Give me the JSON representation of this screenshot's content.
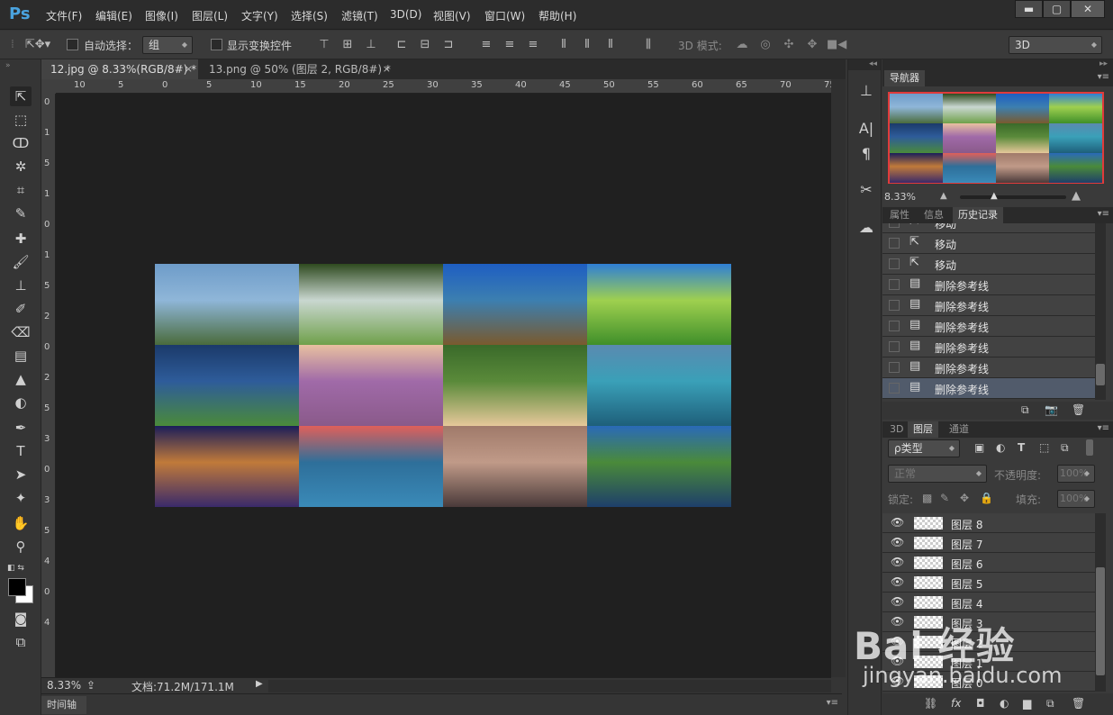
{
  "app": {
    "logo": "Ps"
  },
  "menu": [
    "文件(F)",
    "编辑(E)",
    "图像(I)",
    "图层(L)",
    "文字(Y)",
    "选择(S)",
    "滤镜(T)",
    "3D(D)",
    "视图(V)",
    "窗口(W)",
    "帮助(H)"
  ],
  "window_buttons": [
    "▬",
    "▢",
    "✕"
  ],
  "options": {
    "move_tool_icon": "move-tool-icon",
    "auto_select_label": "自动选择：",
    "auto_select_value": "组",
    "show_transform_label": "显示变换控件",
    "mode_3d_label": "3D 模式:",
    "workspace_value": "3D"
  },
  "tabs": [
    {
      "label": "12.jpg @ 8.33%(RGB/8#) *",
      "close": "×"
    },
    {
      "label": "13.png @ 50% (图层 2, RGB/8#) *",
      "close": "×"
    }
  ],
  "ruler": {
    "top": [
      "10",
      "5",
      "0",
      "5",
      "10",
      "15",
      "20",
      "25",
      "30",
      "35",
      "40",
      "45",
      "50",
      "55",
      "60",
      "65",
      "70",
      "75"
    ],
    "left": [
      "0",
      "1",
      "5",
      "1",
      "0",
      "1",
      "5",
      "2",
      "0",
      "2",
      "5",
      "3",
      "0",
      "3",
      "5",
      "4",
      "0",
      "4"
    ]
  },
  "photos": [
    {
      "name": "mountain-lake-photo",
      "colors": [
        "#6e9cc9",
        "#4a6b3c",
        "#8fb6d8"
      ]
    },
    {
      "name": "waterfall-photo",
      "colors": [
        "#2f4a1f",
        "#6fa04a",
        "#c9d7d0"
      ]
    },
    {
      "name": "sunburst-river-photo",
      "colors": [
        "#1e5ec2",
        "#7a5a2e",
        "#3c7fb0"
      ]
    },
    {
      "name": "green-meadow-photo",
      "colors": [
        "#2f7fd6",
        "#3f8f2a",
        "#9fd04f"
      ]
    },
    {
      "name": "fjord-ship-photo",
      "colors": [
        "#1b3a6a",
        "#4a8a3a",
        "#2e5c9a"
      ]
    },
    {
      "name": "lavender-tree-photo",
      "colors": [
        "#e8c0a0",
        "#8a5a8a",
        "#a06aa8"
      ]
    },
    {
      "name": "golden-puppy-photo",
      "colors": [
        "#3a6a2a",
        "#e6c89a",
        "#5a8a3a"
      ]
    },
    {
      "name": "alpine-castle-lake-photo",
      "colors": [
        "#5a8ab0",
        "#1e5f7a",
        "#3aa0b8"
      ]
    },
    {
      "name": "joshua-tree-night-photo",
      "colors": [
        "#1b1e5a",
        "#3a2a6a",
        "#c07a3a"
      ]
    },
    {
      "name": "sunset-pier-photo",
      "colors": [
        "#e0605a",
        "#3a8ab8",
        "#2e6f9a"
      ]
    },
    {
      "name": "misty-pond-photo",
      "colors": [
        "#a07a6a",
        "#4a3a3a",
        "#c09a88"
      ]
    },
    {
      "name": "coastal-rocks-photo",
      "colors": [
        "#2a6ab8",
        "#1e3f6a",
        "#4a8a3a"
      ]
    }
  ],
  "status": {
    "zoom": "8.33%",
    "doc": "文档:71.2M/171.1M",
    "timeline": "时间轴"
  },
  "navigator": {
    "tab": "导航器",
    "zoom": "8.33%"
  },
  "history": {
    "tabs": [
      "属性",
      "信息",
      "历史记录"
    ],
    "items": [
      {
        "label": "移动",
        "icon": "move-icon"
      },
      {
        "label": "移动",
        "icon": "move-icon"
      },
      {
        "label": "移动",
        "icon": "move-icon"
      },
      {
        "label": "删除参考线",
        "icon": "document-icon"
      },
      {
        "label": "删除参考线",
        "icon": "document-icon"
      },
      {
        "label": "删除参考线",
        "icon": "document-icon"
      },
      {
        "label": "删除参考线",
        "icon": "document-icon"
      },
      {
        "label": "删除参考线",
        "icon": "document-icon"
      },
      {
        "label": "删除参考线",
        "icon": "document-icon"
      }
    ]
  },
  "layers": {
    "tabs": [
      "3D",
      "图层",
      "通道"
    ],
    "filter_label": "ρ类型",
    "blend_mode": "正常",
    "opacity_label": "不透明度:",
    "opacity_value": "100%",
    "lock_label": "锁定:",
    "fill_label": "填充:",
    "fill_value": "100%",
    "items": [
      "图层 8",
      "图层 7",
      "图层 6",
      "图层 5",
      "图层 4",
      "图层 3",
      "图层 2",
      "图层 1",
      "图层 0"
    ]
  },
  "watermark": {
    "brand": "Bai 经验",
    "url": "jingyan.baidu.com"
  }
}
